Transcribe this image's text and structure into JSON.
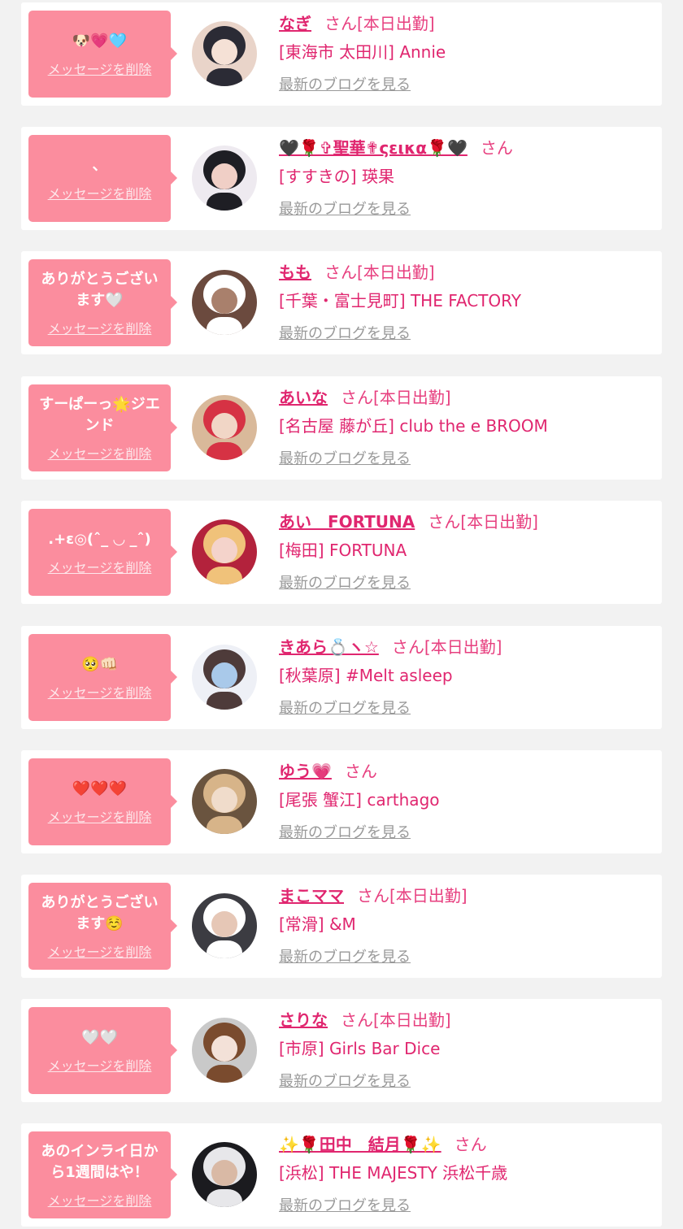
{
  "messages": [
    {
      "bubble_text": "🐶💗🩵",
      "delete_label": "メッセージを削除",
      "cast_name": "なぎ",
      "san_label": "さん",
      "status": "[本日出勤]",
      "shop": "[東海市 太田川] Annie",
      "blog_label": "最新のブログを見る",
      "avatar_colors": [
        "#e9d4c9",
        "#2b2b35",
        "#f5e1d6"
      ]
    },
    {
      "bubble_text": "、",
      "delete_label": "メッセージを削除",
      "cast_name": "🖤🌹✞聖華✟ςεικα🌹🖤",
      "san_label": "さん",
      "status": "",
      "shop": "[すすきの] 瑛果",
      "blog_label": "最新のブログを見る",
      "avatar_colors": [
        "#eeeaf0",
        "#1e1e24",
        "#f0cfc6"
      ]
    },
    {
      "bubble_text": "ありがとうござい\nます🤍",
      "delete_label": "メッセージを削除",
      "cast_name": "もも",
      "san_label": "さん",
      "status": "[本日出勤]",
      "shop": "[千葉・富士見町] THE FACTORY",
      "blog_label": "最新のブログを見る",
      "avatar_colors": [
        "#6b4a3e",
        "#ffffff",
        "#a9806c"
      ]
    },
    {
      "bubble_text": "すーぱーっ🌟ジエ\nンド",
      "delete_label": "メッセージを削除",
      "cast_name": "あいな",
      "san_label": "さん",
      "status": "[本日出勤]",
      "shop": "[名古屋 藤が丘] club the e BROOM",
      "blog_label": "最新のブログを見る",
      "avatar_colors": [
        "#d9b99a",
        "#d63244",
        "#f1d6c6"
      ]
    },
    {
      "bubble_text": ".+ε◎(ˆ_ ◡ _ˆ)",
      "delete_label": "メッセージを削除",
      "cast_name": "あい　FORTUNA",
      "san_label": "さん",
      "status": "[本日出勤]",
      "shop": "[梅田] FORTUNA",
      "blog_label": "最新のブログを見る",
      "avatar_colors": [
        "#b3223c",
        "#f0c27a",
        "#f4d3cb"
      ]
    },
    {
      "bubble_text": "🥺👊🏻",
      "delete_label": "メッセージを削除",
      "cast_name": "きあら💍ヽ☆",
      "san_label": "さん",
      "status": "[本日出勤]",
      "shop": "[秋葉原] #Melt asleep",
      "blog_label": "最新のブログを見る",
      "avatar_colors": [
        "#eef0f6",
        "#4e3b3a",
        "#a9c9ea"
      ]
    },
    {
      "bubble_text": "❤️❤️❤️",
      "delete_label": "メッセージを削除",
      "cast_name": "ゆう💗",
      "san_label": "さん",
      "status": "",
      "shop": "[尾張 蟹江] carthago",
      "blog_label": "最新のブログを見る",
      "avatar_colors": [
        "#6a543f",
        "#d7b489",
        "#f0dccb"
      ]
    },
    {
      "bubble_text": "ありがとうござい\nます☺️",
      "delete_label": "メッセージを削除",
      "cast_name": "まこママ",
      "san_label": "さん",
      "status": "[本日出勤]",
      "shop": "[常滑] &M",
      "blog_label": "最新のブログを見る",
      "avatar_colors": [
        "#3c3c42",
        "#ffffff",
        "#e6c7b6"
      ]
    },
    {
      "bubble_text": "🤍🤍",
      "delete_label": "メッセージを削除",
      "cast_name": "さりな",
      "san_label": "さん",
      "status": "[本日出勤]",
      "shop": "[市原] Girls Bar Dice",
      "blog_label": "最新のブログを見る",
      "avatar_colors": [
        "#c9c9c9",
        "#7a4b2e",
        "#f3e1d8"
      ]
    },
    {
      "bubble_text": "あのインライ日か\nら1週間はや！",
      "delete_label": "メッセージを削除",
      "cast_name": "✨🌹田中　結月🌹✨",
      "san_label": "さん",
      "status": "",
      "shop": "[浜松] THE MAJESTY 浜松千歳",
      "blog_label": "最新のブログを見る",
      "avatar_colors": [
        "#1b1b1f",
        "#e7e7ea",
        "#d9b9a5"
      ]
    }
  ]
}
